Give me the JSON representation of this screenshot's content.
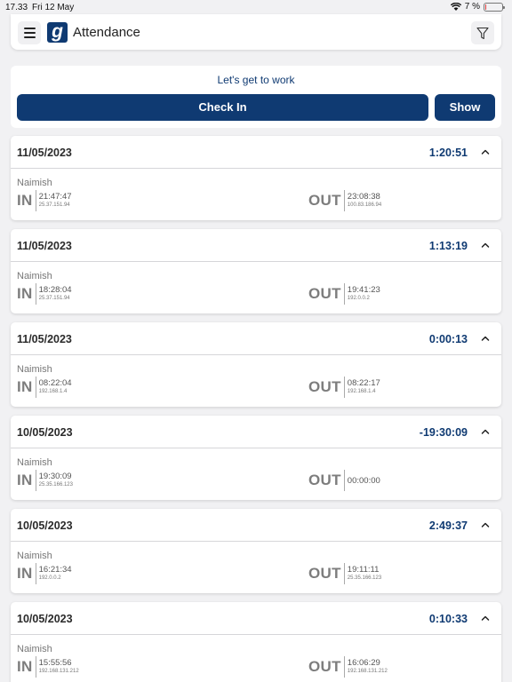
{
  "status_bar": {
    "time": "17.33",
    "date": "Fri 12 May",
    "battery_text": "7 %",
    "battery_level": 0.07,
    "battery_color": "#e23b3b"
  },
  "header": {
    "logo_letter": "g",
    "title": "Attendance",
    "menu_icon": "hamburger-menu-icon",
    "filter_icon": "filter-funnel-icon"
  },
  "checkin": {
    "motto": "Let's get to work",
    "check_in_label": "Check In",
    "show_label": "Show"
  },
  "labels": {
    "in": "IN",
    "out": "OUT"
  },
  "colors": {
    "brand": "#0f3a72",
    "background": "#f1f1f3"
  },
  "records": [
    {
      "date": "11/05/2023",
      "duration": "1:20:51",
      "name": "Naimish",
      "in_time": "21:47:47",
      "in_ip": "25.37.151.94",
      "out_time": "23:08:38",
      "out_ip": "100.83.186.94"
    },
    {
      "date": "11/05/2023",
      "duration": "1:13:19",
      "name": "Naimish",
      "in_time": "18:28:04",
      "in_ip": "25.37.151.94",
      "out_time": "19:41:23",
      "out_ip": "192.0.0.2"
    },
    {
      "date": "11/05/2023",
      "duration": "0:00:13",
      "name": "Naimish",
      "in_time": "08:22:04",
      "in_ip": "192.168.1.4",
      "out_time": "08:22:17",
      "out_ip": "192.168.1.4"
    },
    {
      "date": "10/05/2023",
      "duration": "-19:30:09",
      "name": "Naimish",
      "in_time": "19:30:09",
      "in_ip": "25.35.166.123",
      "out_time": "00:00:00",
      "out_ip": ""
    },
    {
      "date": "10/05/2023",
      "duration": "2:49:37",
      "name": "Naimish",
      "in_time": "16:21:34",
      "in_ip": "192.0.0.2",
      "out_time": "19:11:11",
      "out_ip": "25.35.166.123"
    },
    {
      "date": "10/05/2023",
      "duration": "0:10:33",
      "name": "Naimish",
      "in_time": "15:55:56",
      "in_ip": "192.168.131.212",
      "out_time": "16:06:29",
      "out_ip": "192.168.131.212"
    }
  ]
}
